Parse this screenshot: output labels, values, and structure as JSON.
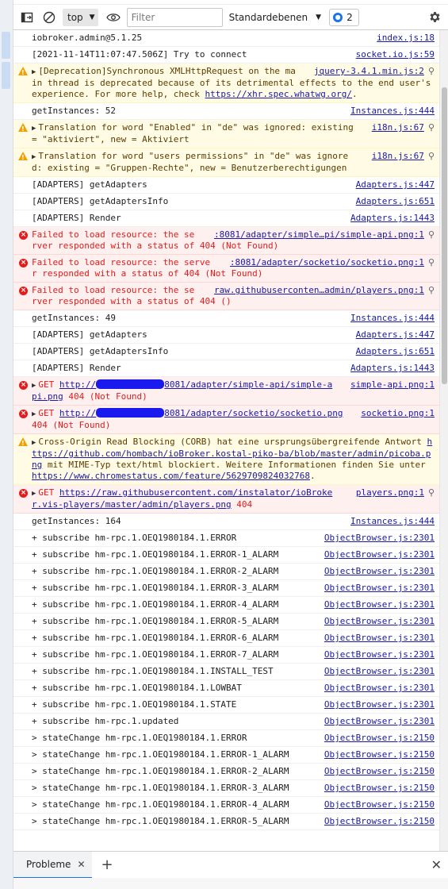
{
  "toolbar": {
    "context": "top",
    "filter_placeholder": "Filter",
    "levels": "Standardebenen",
    "issues_count": "2"
  },
  "messages": [
    {
      "level": "log",
      "text": "iobroker.admin@5.1.25",
      "source": "index.js:18"
    },
    {
      "level": "log",
      "text": "[2021-11-14T11:07:47.506Z] Try to connect",
      "source": "socket.io.js:59"
    },
    {
      "level": "warn",
      "expand": true,
      "text": "[Deprecation]Synchronous XMLHttpRequest on the main thread is deprecated because of its detrimental effects to the end user's experience. For more help, check ",
      "link": "https://xhr.spec.whatwg.org/",
      "after": ".",
      "source": "jquery-3.4.1.min.js:2",
      "magnifier": true
    },
    {
      "level": "log",
      "text": "getInstances: 52",
      "source": "Instances.js:444"
    },
    {
      "level": "warn",
      "expand": true,
      "text": "Translation for word \"Enabled\" in \"de\" was ignored: existing = \"aktiviert\", new = Aktiviert",
      "source": "i18n.js:67",
      "magnifier": true
    },
    {
      "level": "warn",
      "expand": true,
      "text": "Translation for word \"users permissions\" in \"de\" was ignored: existing = \"Gruppen-Rechte\", new = Benutzerberechtigungen",
      "source": "i18n.js:67",
      "magnifier": true
    },
    {
      "level": "log",
      "text": "[ADAPTERS] getAdapters",
      "source": "Adapters.js:447"
    },
    {
      "level": "log",
      "text": "[ADAPTERS] getAdaptersInfo",
      "source": "Adapters.js:651"
    },
    {
      "level": "log",
      "text": "[ADAPTERS] Render",
      "source": "Adapters.js:1443"
    },
    {
      "level": "error",
      "text": "Failed to load resource: the server responded with a status of 404 (Not Found)",
      "source": ":8081/adapter/simple…pi/simple-api.png:1",
      "magnifier": true
    },
    {
      "level": "error",
      "text": "Failed to load resource: the server responded with a status of 404 (Not Found)",
      "source": ":8081/adapter/socketio/socketio.png:1",
      "magnifier": true
    },
    {
      "level": "error",
      "text": "Failed to load resource: the server responded with a status of 404 ()",
      "source": "raw.githubuserconten…admin/players.png:1",
      "magnifier": true
    },
    {
      "level": "log",
      "text": "getInstances: 49",
      "source": "Instances.js:444"
    },
    {
      "level": "log",
      "text": "[ADAPTERS] getAdapters",
      "source": "Adapters.js:447"
    },
    {
      "level": "log",
      "text": "[ADAPTERS] getAdaptersInfo",
      "source": "Adapters.js:651"
    },
    {
      "level": "log",
      "text": "[ADAPTERS] Render",
      "source": "Adapters.js:1443"
    },
    {
      "level": "error",
      "expand": true,
      "text": "GET ",
      "link": "http://",
      "redacted": true,
      "link2": "8081/adapter/simple-api/simple-api.png",
      "after": " 404 (Not Found)",
      "source": "simple-api.png:1"
    },
    {
      "level": "error",
      "expand": true,
      "text": "GET ",
      "link": "http://",
      "redacted": true,
      "link2": "8081/adapter/socketio/socketio.png",
      "after": " 404 (Not Found)",
      "source": "socketio.png:1"
    },
    {
      "level": "warn",
      "expand": true,
      "text": "Cross-Origin Read Blocking (CORB) hat eine ursprungsübergreifende Antwort ",
      "link": "https://github.com/hombach/ioBroker.kostal-piko-ba/blob/master/admin/picoba.png",
      "after": " mit MIME-Typ text/html blockiert. Weitere Informationen finden Sie unter ",
      "link2": "https://www.chromestatus.com/feature/5629709824032768",
      "after2": "."
    },
    {
      "level": "error",
      "expand": true,
      "text": "GET ",
      "link": "https://raw.githubusercontent.com/instalator/ioBroker.vis-players/master/admin/players.png",
      "after": " 404",
      "source": "players.png:1",
      "magnifier": true
    },
    {
      "level": "log",
      "text": "getInstances: 164",
      "source": "Instances.js:444"
    },
    {
      "level": "log",
      "text": "+ subscribe hm-rpc.1.OEQ1980184.1.ERROR",
      "source": "ObjectBrowser.js:2301"
    },
    {
      "level": "log",
      "text": "+ subscribe hm-rpc.1.OEQ1980184.1.ERROR-1_ALARM",
      "source": "ObjectBrowser.js:2301"
    },
    {
      "level": "log",
      "text": "+ subscribe hm-rpc.1.OEQ1980184.1.ERROR-2_ALARM",
      "source": "ObjectBrowser.js:2301"
    },
    {
      "level": "log",
      "text": "+ subscribe hm-rpc.1.OEQ1980184.1.ERROR-3_ALARM",
      "source": "ObjectBrowser.js:2301"
    },
    {
      "level": "log",
      "text": "+ subscribe hm-rpc.1.OEQ1980184.1.ERROR-4_ALARM",
      "source": "ObjectBrowser.js:2301"
    },
    {
      "level": "log",
      "text": "+ subscribe hm-rpc.1.OEQ1980184.1.ERROR-5_ALARM",
      "source": "ObjectBrowser.js:2301"
    },
    {
      "level": "log",
      "text": "+ subscribe hm-rpc.1.OEQ1980184.1.ERROR-6_ALARM",
      "source": "ObjectBrowser.js:2301"
    },
    {
      "level": "log",
      "text": "+ subscribe hm-rpc.1.OEQ1980184.1.ERROR-7_ALARM",
      "source": "ObjectBrowser.js:2301"
    },
    {
      "level": "log",
      "text": "+ subscribe hm-rpc.1.OEQ1980184.1.INSTALL_TEST",
      "source": "ObjectBrowser.js:2301"
    },
    {
      "level": "log",
      "text": "+ subscribe hm-rpc.1.OEQ1980184.1.LOWBAT",
      "source": "ObjectBrowser.js:2301"
    },
    {
      "level": "log",
      "text": "+ subscribe hm-rpc.1.OEQ1980184.1.STATE",
      "source": "ObjectBrowser.js:2301"
    },
    {
      "level": "log",
      "text": "+ subscribe hm-rpc.1.updated",
      "source": "ObjectBrowser.js:2301"
    },
    {
      "level": "log",
      "text": "> stateChange hm-rpc.1.OEQ1980184.1.ERROR",
      "source": "ObjectBrowser.js:2150"
    },
    {
      "level": "log",
      "text": "> stateChange hm-rpc.1.OEQ1980184.1.ERROR-1_ALARM",
      "source": "ObjectBrowser.js:2150"
    },
    {
      "level": "log",
      "text": "> stateChange hm-rpc.1.OEQ1980184.1.ERROR-2_ALARM",
      "source": "ObjectBrowser.js:2150"
    },
    {
      "level": "log",
      "text": "> stateChange hm-rpc.1.OEQ1980184.1.ERROR-3_ALARM",
      "source": "ObjectBrowser.js:2150"
    },
    {
      "level": "log",
      "text": "> stateChange hm-rpc.1.OEQ1980184.1.ERROR-4_ALARM",
      "source": "ObjectBrowser.js:2150"
    },
    {
      "level": "log",
      "text": "> stateChange hm-rpc.1.OEQ1980184.1.ERROR-5_ALARM",
      "source": "ObjectBrowser.js:2150"
    }
  ],
  "drawer": {
    "tab_label": "Probleme"
  }
}
